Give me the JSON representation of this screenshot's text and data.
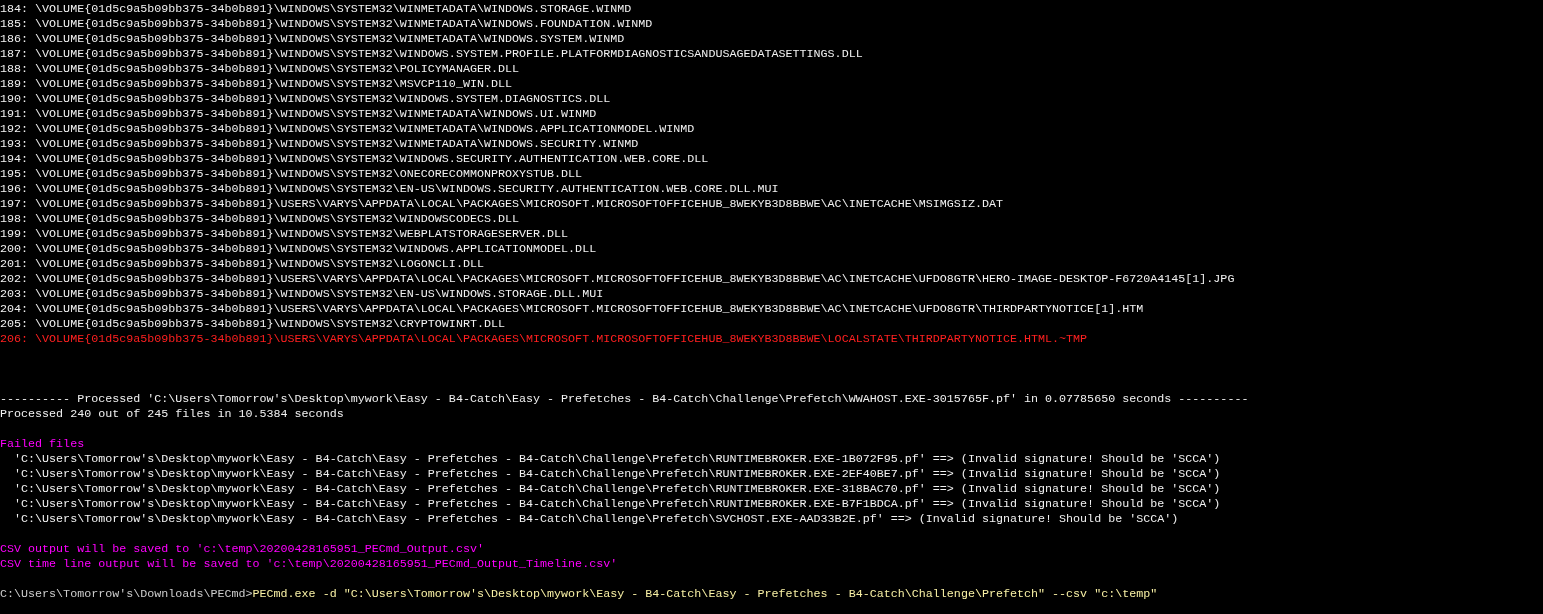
{
  "file_list": [
    {
      "text": "184: \\VOLUME{01d5c9a5b09bb375-34b0b891}\\WINDOWS\\SYSTEM32\\WINMETADATA\\WINDOWS.STORAGE.WINMD",
      "kind": "normal"
    },
    {
      "text": "185: \\VOLUME{01d5c9a5b09bb375-34b0b891}\\WINDOWS\\SYSTEM32\\WINMETADATA\\WINDOWS.FOUNDATION.WINMD",
      "kind": "normal"
    },
    {
      "text": "186: \\VOLUME{01d5c9a5b09bb375-34b0b891}\\WINDOWS\\SYSTEM32\\WINMETADATA\\WINDOWS.SYSTEM.WINMD",
      "kind": "normal"
    },
    {
      "text": "187: \\VOLUME{01d5c9a5b09bb375-34b0b891}\\WINDOWS\\SYSTEM32\\WINDOWS.SYSTEM.PROFILE.PLATFORMDIAGNOSTICSANDUSAGEDATASETTINGS.DLL",
      "kind": "normal"
    },
    {
      "text": "188: \\VOLUME{01d5c9a5b09bb375-34b0b891}\\WINDOWS\\SYSTEM32\\POLICYMANAGER.DLL",
      "kind": "normal"
    },
    {
      "text": "189: \\VOLUME{01d5c9a5b09bb375-34b0b891}\\WINDOWS\\SYSTEM32\\MSVCP110_WIN.DLL",
      "kind": "normal"
    },
    {
      "text": "190: \\VOLUME{01d5c9a5b09bb375-34b0b891}\\WINDOWS\\SYSTEM32\\WINDOWS.SYSTEM.DIAGNOSTICS.DLL",
      "kind": "normal"
    },
    {
      "text": "191: \\VOLUME{01d5c9a5b09bb375-34b0b891}\\WINDOWS\\SYSTEM32\\WINMETADATA\\WINDOWS.UI.WINMD",
      "kind": "normal"
    },
    {
      "text": "192: \\VOLUME{01d5c9a5b09bb375-34b0b891}\\WINDOWS\\SYSTEM32\\WINMETADATA\\WINDOWS.APPLICATIONMODEL.WINMD",
      "kind": "normal"
    },
    {
      "text": "193: \\VOLUME{01d5c9a5b09bb375-34b0b891}\\WINDOWS\\SYSTEM32\\WINMETADATA\\WINDOWS.SECURITY.WINMD",
      "kind": "normal"
    },
    {
      "text": "194: \\VOLUME{01d5c9a5b09bb375-34b0b891}\\WINDOWS\\SYSTEM32\\WINDOWS.SECURITY.AUTHENTICATION.WEB.CORE.DLL",
      "kind": "normal"
    },
    {
      "text": "195: \\VOLUME{01d5c9a5b09bb375-34b0b891}\\WINDOWS\\SYSTEM32\\ONECORECOMMONPROXYSTUB.DLL",
      "kind": "normal"
    },
    {
      "text": "196: \\VOLUME{01d5c9a5b09bb375-34b0b891}\\WINDOWS\\SYSTEM32\\EN-US\\WINDOWS.SECURITY.AUTHENTICATION.WEB.CORE.DLL.MUI",
      "kind": "normal"
    },
    {
      "text": "197: \\VOLUME{01d5c9a5b09bb375-34b0b891}\\USERS\\VARYS\\APPDATA\\LOCAL\\PACKAGES\\MICROSOFT.MICROSOFTOFFICEHUB_8WEKYB3D8BBWE\\AC\\INETCACHE\\MSIMGSIZ.DAT",
      "kind": "normal"
    },
    {
      "text": "198: \\VOLUME{01d5c9a5b09bb375-34b0b891}\\WINDOWS\\SYSTEM32\\WINDOWSCODECS.DLL",
      "kind": "normal"
    },
    {
      "text": "199: \\VOLUME{01d5c9a5b09bb375-34b0b891}\\WINDOWS\\SYSTEM32\\WEBPLATSTORAGESERVER.DLL",
      "kind": "normal"
    },
    {
      "text": "200: \\VOLUME{01d5c9a5b09bb375-34b0b891}\\WINDOWS\\SYSTEM32\\WINDOWS.APPLICATIONMODEL.DLL",
      "kind": "normal"
    },
    {
      "text": "201: \\VOLUME{01d5c9a5b09bb375-34b0b891}\\WINDOWS\\SYSTEM32\\LOGONCLI.DLL",
      "kind": "normal"
    },
    {
      "text": "202: \\VOLUME{01d5c9a5b09bb375-34b0b891}\\USERS\\VARYS\\APPDATA\\LOCAL\\PACKAGES\\MICROSOFT.MICROSOFTOFFICEHUB_8WEKYB3D8BBWE\\AC\\INETCACHE\\UFDO8GTR\\HERO-IMAGE-DESKTOP-F6720A4145[1].JPG",
      "kind": "normal"
    },
    {
      "text": "203: \\VOLUME{01d5c9a5b09bb375-34b0b891}\\WINDOWS\\SYSTEM32\\EN-US\\WINDOWS.STORAGE.DLL.MUI",
      "kind": "normal"
    },
    {
      "text": "204: \\VOLUME{01d5c9a5b09bb375-34b0b891}\\USERS\\VARYS\\APPDATA\\LOCAL\\PACKAGES\\MICROSOFT.MICROSOFTOFFICEHUB_8WEKYB3D8BBWE\\AC\\INETCACHE\\UFDO8GTR\\THIRDPARTYNOTICE[1].HTM",
      "kind": "normal"
    },
    {
      "text": "205: \\VOLUME{01d5c9a5b09bb375-34b0b891}\\WINDOWS\\SYSTEM32\\CRYPTOWINRT.DLL",
      "kind": "normal"
    },
    {
      "text": "206: \\VOLUME{01d5c9a5b09bb375-34b0b891}\\USERS\\VARYS\\APPDATA\\LOCAL\\PACKAGES\\MICROSOFT.MICROSOFTOFFICEHUB_8WEKYB3D8BBWE\\LOCALSTATE\\THIRDPARTYNOTICE.HTML.~TMP",
      "kind": "error"
    }
  ],
  "summary": [
    "---------- Processed 'C:\\Users\\Tomorrow's\\Desktop\\mywork\\Easy - B4-Catch\\Easy - Prefetches - B4-Catch\\Challenge\\Prefetch\\WWAHOST.EXE-3015765F.pf' in 0.07785650 seconds ----------",
    "Processed 240 out of 245 files in 10.5384 seconds"
  ],
  "failed_files": {
    "title": "Failed files",
    "items": [
      "  'C:\\Users\\Tomorrow's\\Desktop\\mywork\\Easy - B4-Catch\\Easy - Prefetches - B4-Catch\\Challenge\\Prefetch\\RUNTIMEBROKER.EXE-1B072F95.pf' ==> (Invalid signature! Should be 'SCCA')",
      "  'C:\\Users\\Tomorrow's\\Desktop\\mywork\\Easy - B4-Catch\\Easy - Prefetches - B4-Catch\\Challenge\\Prefetch\\RUNTIMEBROKER.EXE-2EF40BE7.pf' ==> (Invalid signature! Should be 'SCCA')",
      "  'C:\\Users\\Tomorrow's\\Desktop\\mywork\\Easy - B4-Catch\\Easy - Prefetches - B4-Catch\\Challenge\\Prefetch\\RUNTIMEBROKER.EXE-318BAC70.pf' ==> (Invalid signature! Should be 'SCCA')",
      "  'C:\\Users\\Tomorrow's\\Desktop\\mywork\\Easy - B4-Catch\\Easy - Prefetches - B4-Catch\\Challenge\\Prefetch\\RUNTIMEBROKER.EXE-B7F1BDCA.pf' ==> (Invalid signature! Should be 'SCCA')",
      "  'C:\\Users\\Tomorrow's\\Desktop\\mywork\\Easy - B4-Catch\\Easy - Prefetches - B4-Catch\\Challenge\\Prefetch\\SVCHOST.EXE-AAD33B2E.pf' ==> (Invalid signature! Should be 'SCCA')"
    ]
  },
  "csv_messages": [
    "CSV output will be saved to 'c:\\temp\\20200428165951_PECmd_Output.csv'",
    "CSV time line output will be saved to 'c:\\temp\\20200428165951_PECmd_Output_Timeline.csv'"
  ],
  "prompt": {
    "path": "C:\\Users\\Tomorrow's\\Downloads\\PECmd>",
    "command": "PECmd.exe -d \"C:\\Users\\Tomorrow's\\Desktop\\mywork\\Easy - B4-Catch\\Easy - Prefetches - B4-Catch\\Challenge\\Prefetch\" --csv \"c:\\temp\""
  }
}
